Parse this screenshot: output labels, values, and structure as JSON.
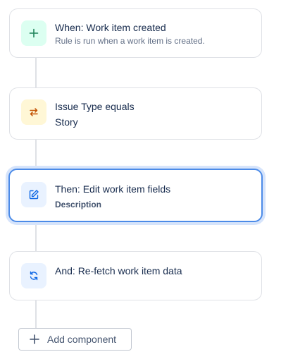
{
  "colors": {
    "connector": "#dfe1e6",
    "selected_border": "#4c8be8",
    "trigger_icon_bg": "#dcfff1",
    "trigger_icon": "#1f845a",
    "condition_icon_bg": "#fff7d6",
    "condition_icon": "#c25100",
    "action_icon_bg": "#e9f2ff",
    "action_icon": "#0c66e4"
  },
  "steps": [
    {
      "icon": "plus-icon",
      "title": "When: Work item created",
      "subtitle": "Rule is run when a work item is created."
    },
    {
      "icon": "swap-arrows-icon",
      "title": "Issue Type equals",
      "subtitle": "Story"
    },
    {
      "icon": "edit-icon",
      "title": "Then: Edit work item fields",
      "subtitle": "Description",
      "selected": true
    },
    {
      "icon": "refresh-icon",
      "title": "And: Re-fetch work item data"
    }
  ],
  "add_button": {
    "icon": "plus-icon",
    "label": "Add component"
  }
}
